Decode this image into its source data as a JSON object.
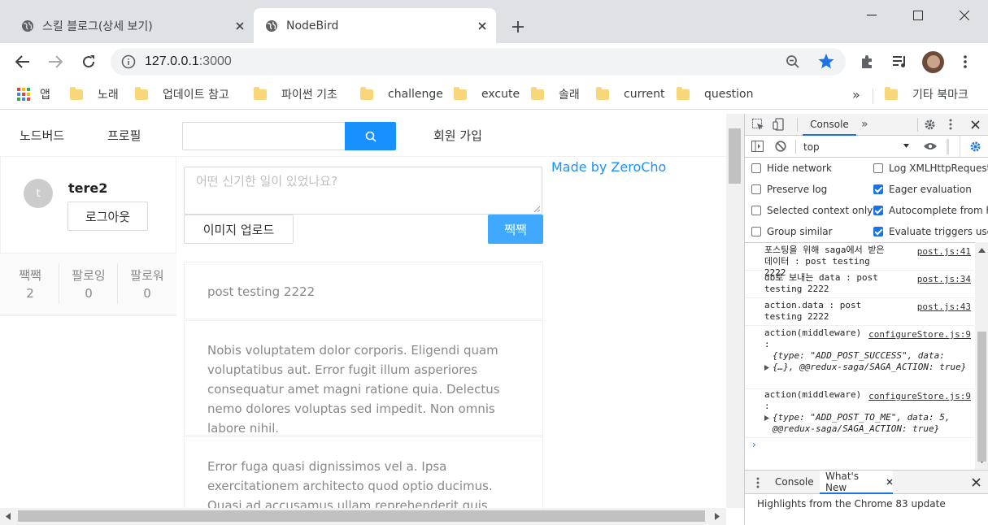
{
  "browser": {
    "tabs": [
      {
        "title": "스킬 블로그(상세 보기)",
        "active": false
      },
      {
        "title": "NodeBird",
        "active": true
      }
    ],
    "url_host": "127.0.0.1",
    "url_port": ":3000",
    "bookmarks": [
      {
        "label": "앱",
        "icon": "apps-grid-icon"
      },
      {
        "label": "노래",
        "icon": "folder-icon"
      },
      {
        "label": "업데이트 참고",
        "icon": "folder-icon"
      },
      {
        "label": "파이썬 기초",
        "icon": "folder-icon"
      },
      {
        "label": "challenge",
        "icon": "folder-icon"
      },
      {
        "label": "excute",
        "icon": "folder-icon"
      },
      {
        "label": "솔래",
        "icon": "folder-icon"
      },
      {
        "label": "current",
        "icon": "folder-icon"
      },
      {
        "label": "question",
        "icon": "folder-icon"
      }
    ],
    "bookmarks_more": "»",
    "other_bookmarks": "기타 북마크",
    "accent": "#1a73e8"
  },
  "page": {
    "nav": {
      "home": "노드버드",
      "profile": "프로필",
      "signup": "회원 가입"
    },
    "user": {
      "avatar_letter": "t",
      "nickname": "tere2",
      "logout_label": "로그아웃"
    },
    "stats": [
      {
        "label": "짹짹",
        "value": "2"
      },
      {
        "label": "팔로잉",
        "value": "0"
      },
      {
        "label": "팔로워",
        "value": "0"
      }
    ],
    "post_form": {
      "placeholder": "어떤 신기한 일이 있었나요?",
      "upload_label": "이미지 업로드",
      "submit_label": "짹짹"
    },
    "made_by": "Made by ZeroCho",
    "posts": [
      {
        "content": "post testing 2222"
      },
      {
        "content": "Nobis voluptatem dolor corporis. Eligendi quam voluptatibus aut. Error fugit illum asperiores consequatur amet magni ratione quia. Delectus nemo dolores voluptas sed impedit. Non omnis labore nihil."
      },
      {
        "content": "Error fuga quasi dignissimos vel a. Ipsa exercitationem architecto quod optio ducimus. Quasi ad accusamus ullam reprehenderit quis porro incidunt esse. Modi ab"
      }
    ],
    "primary_color": "#1890ff"
  },
  "devtools": {
    "console_tab": "Console",
    "context": "top",
    "options": [
      {
        "label": "Hide network",
        "checked": false
      },
      {
        "label": "Log XMLHttpRequests",
        "checked": false
      },
      {
        "label": "Preserve log",
        "checked": false
      },
      {
        "label": "Eager evaluation",
        "checked": true
      },
      {
        "label": "Selected context only",
        "checked": false
      },
      {
        "label": "Autocomplete from his",
        "checked": true
      },
      {
        "label": "Group similar",
        "checked": false
      },
      {
        "label": "Evaluate triggers user a",
        "checked": true
      }
    ],
    "messages": [
      {
        "text": "포스팅을 위해 saga에서 받은 데이터 :  post testing 2222",
        "source": "post.js:41"
      },
      {
        "text": "db로 보내는 data : post testing 2222",
        "source": "post.js:34"
      },
      {
        "text": "action.data :  post testing 2222",
        "source": "post.js:43"
      },
      {
        "text": "action(middleware) :",
        "source": "configureStore.js:9",
        "obj_line1": "{type: \"ADD_POST_SUCCESS\", data: {…}, @@redux-saga/SAGA_ACTION: true}"
      },
      {
        "text": "action(middleware) :",
        "source": "configureStore.js:9",
        "obj_line1": "{type: \"ADD_POST_TO_ME\", data: 5, @@redux-saga/SAGA_ACTION: true}"
      }
    ],
    "drawer_tabs": [
      "Console",
      "What's New"
    ],
    "drawer_text": "Highlights from the Chrome 83 update"
  }
}
